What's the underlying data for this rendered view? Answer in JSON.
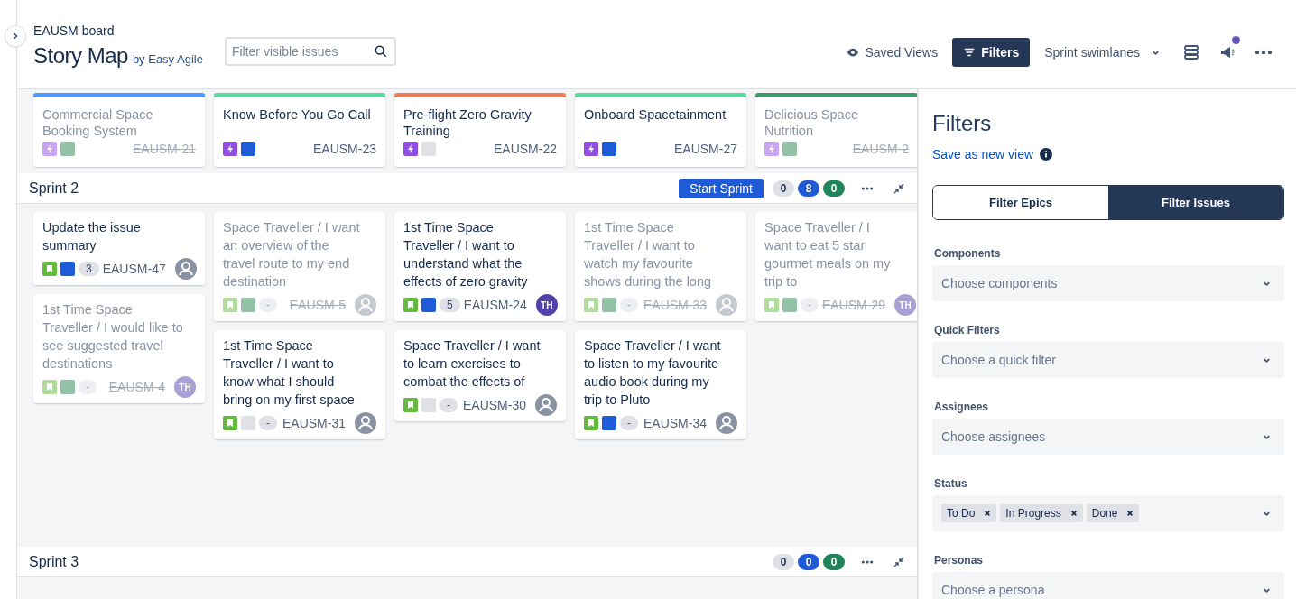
{
  "header": {
    "board_name": "EAUSM board",
    "title": "Story Map",
    "byline": "by Easy Agile",
    "search": {
      "placeholder": "Filter visible issues"
    },
    "saved_views": "Saved Views",
    "filters_button": {
      "label": "Filters",
      "selected": true
    },
    "swimlanes": "Sprint swimlanes",
    "notification_dot": true
  },
  "epics": [
    {
      "title": "Commercial Space Booking System",
      "key": "EAUSM-21",
      "done": true,
      "color": "#4c9aff",
      "swatch": {
        "color": "#93c1a6"
      }
    },
    {
      "title": "Know Before You Go Call",
      "key": "EAUSM-23",
      "done": false,
      "color": "#57d9a3",
      "swatch": {
        "color": "#1f5bd6"
      }
    },
    {
      "title": "Pre-flight Zero Gravity Training",
      "key": "EAUSM-22",
      "done": false,
      "color": "#f07e57",
      "swatch": {
        "color": "#dfe1e6"
      }
    },
    {
      "title": "Onboard Spacetainment",
      "key": "EAUSM-27",
      "done": false,
      "color": "#57d9a3",
      "swatch": {
        "color": "#1f5bd6"
      }
    },
    {
      "title": "Delicious Space Nutrition",
      "key": "EAUSM-2",
      "done": true,
      "color": "#3f9a6a",
      "swatch": {
        "color": "#93c1a6"
      }
    }
  ],
  "sprints": [
    {
      "name": "Sprint 2",
      "start_button": "Start Sprint",
      "counts": [
        {
          "value": "0",
          "color": "#dfe1e6"
        },
        {
          "value": "8",
          "color": "#1f5bd6"
        },
        {
          "value": "0",
          "color": "#1f845a"
        }
      ],
      "columns": [
        [
          {
            "title": "Update the issue summary",
            "key": "EAUSM-47",
            "done": false,
            "kind": "story",
            "swatch": {
              "color": "#1f5bd6"
            },
            "estimate": "3",
            "assignee": {
              "kind": "person"
            }
          },
          {
            "title": "1st Time Space Traveller / I would like to see suggested travel destinations",
            "key": "EAUSM-4",
            "done": true,
            "kind": "story",
            "swatch": {
              "color": "#93c1a6"
            },
            "estimate": "-",
            "assignee": {
              "kind": "initials",
              "initials": "TH"
            }
          }
        ],
        [
          {
            "title": "Space Traveller / I want an overview of the travel route to my end destination",
            "key": "EAUSM-5",
            "done": true,
            "kind": "story",
            "swatch": {
              "color": "#93c1a6"
            },
            "estimate": "-",
            "assignee": {
              "kind": "person"
            }
          },
          {
            "title": "1st Time Space Traveller / I want to know what I should bring on my first space",
            "key": "EAUSM-31",
            "done": false,
            "kind": "story",
            "swatch": {
              "color": "#dfe1e6"
            },
            "estimate": "-",
            "assignee": {
              "kind": "person"
            }
          }
        ],
        [
          {
            "title": "1st Time Space Traveller / I want to understand what the effects of zero gravity",
            "key": "EAUSM-24",
            "done": false,
            "kind": "story",
            "swatch": {
              "color": "#1f5bd6"
            },
            "estimate": "5",
            "assignee": {
              "kind": "initials",
              "initials": "TH"
            }
          },
          {
            "title": "Space Traveller / I want to learn exercises to combat the effects of",
            "key": "EAUSM-30",
            "done": false,
            "kind": "story",
            "swatch": {
              "color": "#dfe1e6"
            },
            "estimate": "-",
            "assignee": {
              "kind": "person"
            }
          }
        ],
        [
          {
            "title": "1st Time Space Traveller / I want to watch my favourite shows during the long",
            "key": "EAUSM-33",
            "done": true,
            "kind": "story",
            "swatch": {
              "color": "#93c1a6"
            },
            "estimate": "-",
            "assignee": {
              "kind": "person"
            }
          },
          {
            "title": "Space Traveller / I want to listen to my favourite audio book during my trip to Pluto",
            "key": "EAUSM-34",
            "done": false,
            "kind": "story",
            "swatch": {
              "color": "#1f5bd6"
            },
            "estimate": "-",
            "assignee": {
              "kind": "person"
            }
          }
        ],
        [
          {
            "title": "Space Traveller / I want to eat 5 star gourmet meals on my trip to",
            "key": "EAUSM-29",
            "done": true,
            "kind": "story",
            "swatch": {
              "color": "#93c1a6"
            },
            "estimate": "-",
            "assignee": {
              "kind": "initials",
              "initials": "TH"
            }
          }
        ]
      ]
    },
    {
      "name": "Sprint 3",
      "counts": [
        {
          "value": "0",
          "color": "#dfe1e6"
        },
        {
          "value": "0",
          "color": "#1f5bd6"
        },
        {
          "value": "0",
          "color": "#1f845a"
        }
      ]
    }
  ],
  "filters_panel": {
    "title": "Filters",
    "save_link": "Save as new view",
    "tabs": [
      {
        "label": "Filter Epics",
        "selected": false
      },
      {
        "label": "Filter Issues",
        "selected": true
      }
    ],
    "fields": [
      {
        "label": "Components",
        "placeholder": "Choose components"
      },
      {
        "label": "Quick Filters",
        "placeholder": "Choose a quick filter"
      },
      {
        "label": "Assignees",
        "placeholder": "Choose assignees"
      },
      {
        "label": "Status",
        "chips": [
          "To Do",
          "In Progress",
          "Done"
        ]
      },
      {
        "label": "Personas",
        "placeholder": "Choose a persona"
      }
    ]
  }
}
